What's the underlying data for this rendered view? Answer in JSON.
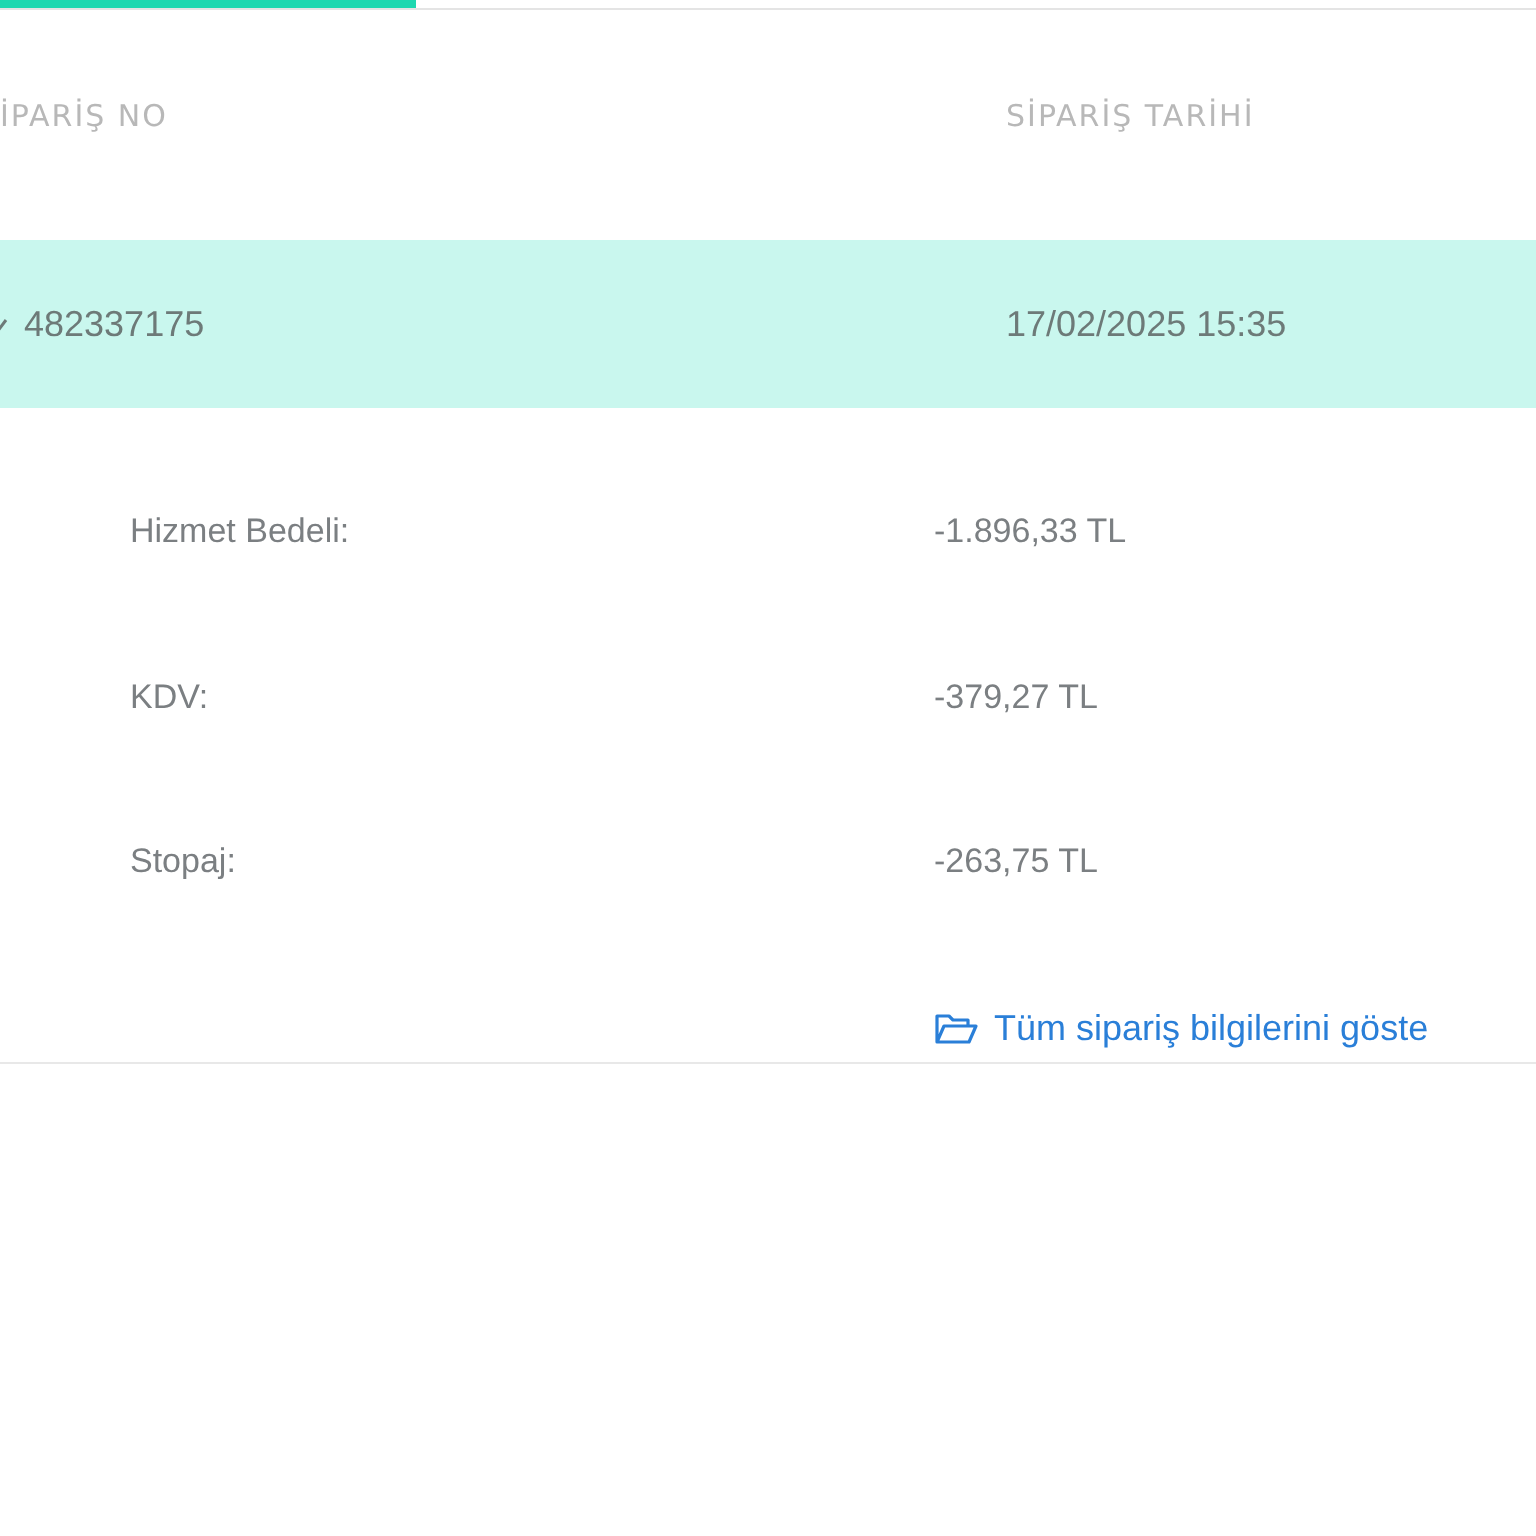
{
  "table": {
    "columns": [
      "İPARİŞ NO",
      "SİPARİŞ TARİHİ"
    ],
    "rows": [
      {
        "order_no": "482337175",
        "date": "17/02/2025 15:35",
        "selected": true,
        "expanded": true,
        "details": [
          {
            "label": "Hizmet Bedeli:",
            "value": "-1.896,33 TL"
          },
          {
            "label": "KDV:",
            "value": "-379,27 TL"
          },
          {
            "label": "Stopaj:",
            "value": "-263,75 TL"
          }
        ],
        "link": "Tüm sipariş bilgilerini göste"
      }
    ]
  }
}
